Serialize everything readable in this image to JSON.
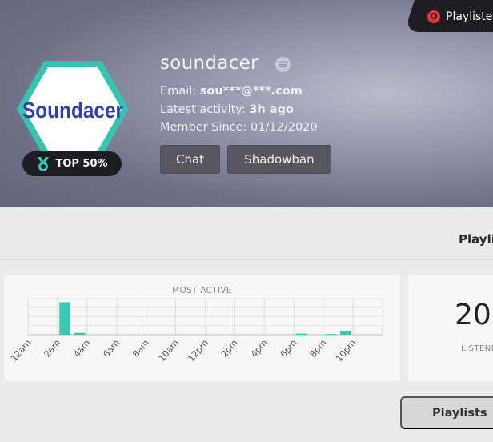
{
  "header": {
    "playlist_tab_label": "Playlisters",
    "username": "soundacer",
    "logo_text": "Soundacer",
    "badge_label": "TOP 50%",
    "email_label": "Email:",
    "email_value": "sou***@***.com",
    "activity_label": "Latest activity:",
    "activity_value": "3h ago",
    "member_since": "Member Since: 01/12/2020",
    "chat_button": "Chat",
    "shadowban_button": "Shadowban"
  },
  "section": {
    "title": "Playlists"
  },
  "stats": {
    "value": "20",
    "label": "LISTENERS"
  },
  "playlists_button": "Playlists",
  "colors": {
    "accent": "#37c8b4",
    "brand_blue": "#2f3ea8",
    "avatar_border": "#36c3b0",
    "dark": "#1e1e22",
    "spotify_icon": "#c9c9d2"
  },
  "icons": {
    "playlist_tab": "playlister-logo-icon",
    "badge": "medal-icon",
    "service": "spotify-icon"
  },
  "chart_data": {
    "type": "bar",
    "title": "MOST ACTIVE",
    "categories": [
      "12am",
      "1am",
      "2am",
      "3am",
      "4am",
      "5am",
      "6am",
      "7am",
      "8am",
      "9am",
      "10am",
      "11am",
      "12pm",
      "1pm",
      "2pm",
      "3pm",
      "4pm",
      "5pm",
      "6pm",
      "7pm",
      "8pm",
      "9pm",
      "10pm",
      "11pm"
    ],
    "tick_labels": [
      "12am",
      "2am",
      "4am",
      "6am",
      "8am",
      "10am",
      "12pm",
      "2pm",
      "4pm",
      "6pm",
      "8pm",
      "10pm"
    ],
    "values": [
      0,
      0,
      9,
      0.5,
      0,
      0,
      0,
      0,
      0,
      0,
      0,
      0,
      0,
      0,
      0,
      0,
      0,
      0,
      0.3,
      0,
      0.2,
      1,
      0,
      0
    ],
    "ylim": [
      0,
      10
    ],
    "grid": true,
    "legend": "none"
  }
}
